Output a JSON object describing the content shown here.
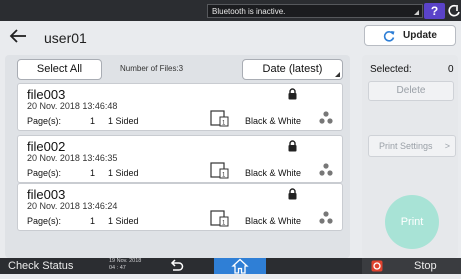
{
  "status_bar": {
    "message": "Bluetooth is inactive.",
    "help_label": "?"
  },
  "header": {
    "title": "user01",
    "update_label": "Update"
  },
  "list_toolbar": {
    "select_all_label": "Select All",
    "number_of_files": "Number of Files:3",
    "sort_label": "Date (latest)"
  },
  "files": [
    {
      "name": "file003",
      "date": "20 Nov. 2018 13:46:48",
      "pages_label": "Page(s):",
      "pages": "1",
      "sided": "1 Sided",
      "color": "Black & White"
    },
    {
      "name": "file002",
      "date": "20 Nov. 2018 13:46:35",
      "pages_label": "Page(s):",
      "pages": "1",
      "sided": "1 Sided",
      "color": "Black & White"
    },
    {
      "name": "file003",
      "date": "20 Nov. 2018 13:46:24",
      "pages_label": "Page(s):",
      "pages": "1",
      "sided": "1 Sided",
      "color": "Black & White"
    }
  ],
  "side_panel": {
    "selected_label": "Selected:",
    "selected_count": "0",
    "delete_label": "Delete",
    "print_settings_label": "Print Settings",
    "print_settings_chevron": ">",
    "print_label": "Print"
  },
  "bottom_bar": {
    "check_status_label": "Check Status",
    "date": "19 Nov. 2018",
    "time": "04 : 47",
    "stop_label": "Stop"
  },
  "colors": {
    "accent": "#2f7fd6",
    "print_button": "#a8e3d6",
    "help_button": "#5a43c9",
    "stop_icon": "#e0422e"
  },
  "icons": [
    "power-icon",
    "back-arrow-icon",
    "refresh-icon",
    "lock-icon",
    "document-icon",
    "staple-icon",
    "home-icon",
    "stop-icon"
  ]
}
